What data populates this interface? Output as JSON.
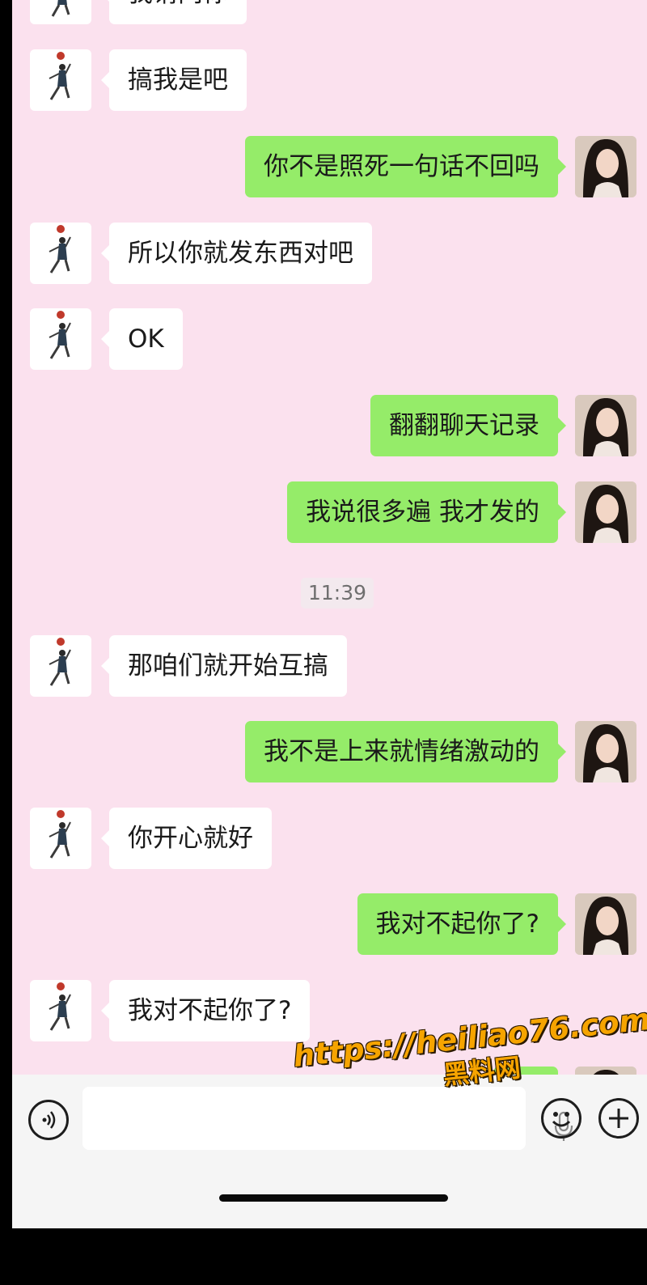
{
  "chat": {
    "messages": [
      {
        "side": "left",
        "text": "我请问你"
      },
      {
        "side": "left",
        "text": "搞我是吧"
      },
      {
        "side": "right",
        "text": "你不是照死一句话不回吗"
      },
      {
        "side": "left",
        "text": "所以你就发东西对吧"
      },
      {
        "side": "left",
        "text": "OK"
      },
      {
        "side": "right",
        "text": "翻翻聊天记录"
      },
      {
        "side": "right",
        "text": "我说很多遍 我才发的"
      },
      {
        "type": "time",
        "text": "11:39"
      },
      {
        "side": "left",
        "text": "那咱们就开始互搞"
      },
      {
        "side": "right",
        "text": "我不是上来就情绪激动的"
      },
      {
        "side": "left",
        "text": "你开心就好"
      },
      {
        "side": "right",
        "text": "我对不起你了?"
      },
      {
        "side": "left",
        "text": "我对不起你了?"
      }
    ]
  },
  "toolbar": {
    "voice_icon": "voice-icon",
    "mic_icon": "microphone-icon",
    "emoji_icon": "emoji-icon",
    "plus_icon": "plus-icon"
  },
  "watermark": {
    "url": "https://heiliao76.com",
    "name": "黑料网"
  },
  "colors": {
    "background": "#fbe1ee",
    "sent_bubble": "#95ec69",
    "received_bubble": "#ffffff",
    "watermark": "#f6a400"
  }
}
